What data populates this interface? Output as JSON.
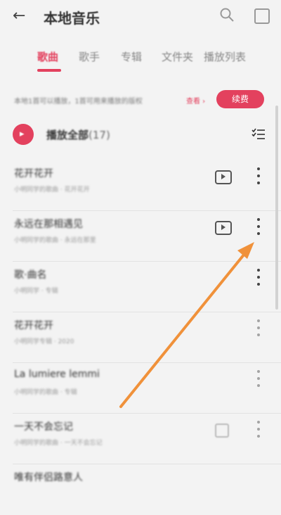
{
  "header": {
    "back_icon": "arrow-left-icon",
    "title": "本地音乐"
  },
  "tabs": [
    "歌曲",
    "歌手",
    "专辑",
    "文件夹",
    "播放列表"
  ],
  "vip_bar": {
    "text": "本地1首可以播放，1首可用来播放的版权",
    "link": "查看 ›",
    "button": "续费"
  },
  "section": {
    "icon_text": "▸",
    "title": "播放全部",
    "count": "(17)"
  },
  "songs": [
    {
      "name": "花开花开",
      "sub": "小明同学的歌曲 · 花开花开"
    },
    {
      "name": "永远在那相遇见",
      "sub": "小明同学的歌曲 · 永远在那里"
    },
    {
      "name": "歌·曲名",
      "sub": "小明同学 · 专辑"
    },
    {
      "name": "花开花开",
      "sub": "小明同学专辑 · 2020"
    },
    {
      "name": "La lumiere lemmi",
      "sub": "小明同学的歌曲 · 专辑"
    },
    {
      "name": "一天不会忘记",
      "sub": "小明同学的歌曲 · 一天不会忘记"
    },
    {
      "name": "唯有伴侣路意人",
      "sub": ""
    }
  ],
  "colors": {
    "accent": "#e3415e",
    "annotation_arrow": "#f0913a"
  }
}
